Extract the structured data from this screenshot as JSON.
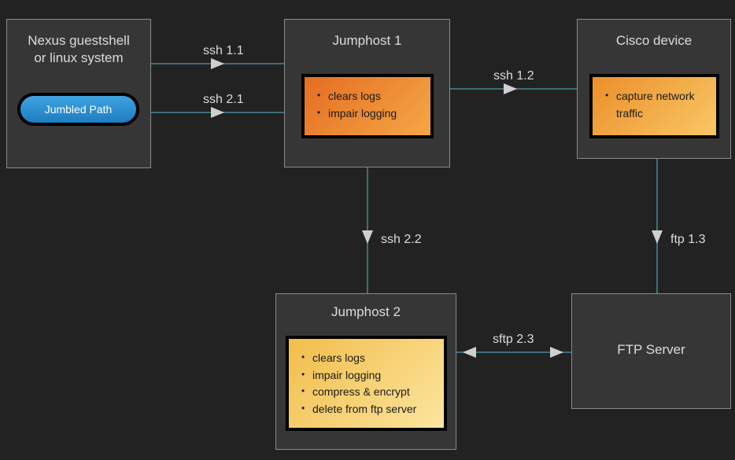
{
  "nodes": {
    "nexus": {
      "title_line1": "Nexus guestshell",
      "title_line2": "or linux system",
      "pill": "Jumbled Path"
    },
    "jumphost1": {
      "title": "Jumphost 1",
      "actions": [
        "clears logs",
        "impair logging"
      ]
    },
    "cisco": {
      "title": "Cisco device",
      "actions": [
        "capture network traffic"
      ]
    },
    "jumphost2": {
      "title": "Jumphost 2",
      "actions": [
        "clears logs",
        "impair logging",
        "compress & encrypt",
        "delete from ftp server"
      ]
    },
    "ftp": {
      "title": "FTP Server"
    }
  },
  "edges": {
    "ssh11": "ssh 1.1",
    "ssh21": "ssh 2.1",
    "ssh12": "ssh 1.2",
    "ssh22": "ssh 2.2",
    "ftp13": "ftp 1.3",
    "sftp23": "sftp 2.3"
  }
}
